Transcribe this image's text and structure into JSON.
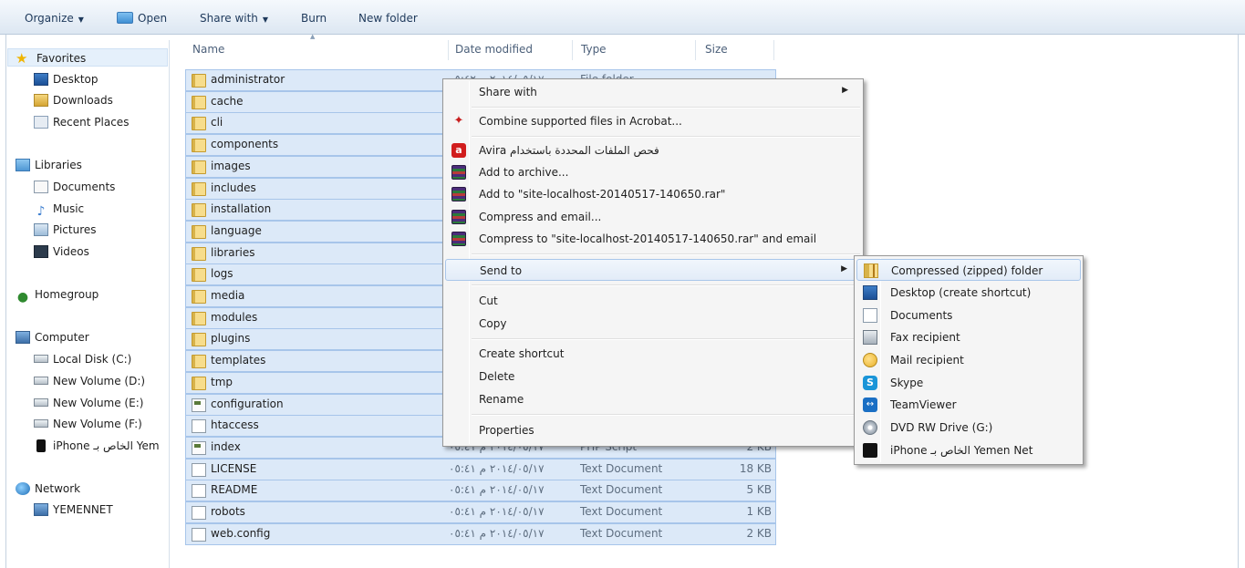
{
  "toolbar": {
    "organize": "Organize",
    "open": "Open",
    "share_with": "Share with",
    "burn": "Burn",
    "new_folder": "New folder"
  },
  "nav": {
    "favorites": "Favorites",
    "desktop": "Desktop",
    "downloads": "Downloads",
    "recent_places": "Recent Places",
    "libraries": "Libraries",
    "documents": "Documents",
    "music": "Music",
    "pictures": "Pictures",
    "videos": "Videos",
    "homegroup": "Homegroup",
    "computer": "Computer",
    "local_disk": "Local Disk (C:)",
    "vol_d": "New Volume (D:)",
    "vol_e": "New Volume (E:)",
    "vol_f": "New Volume (F:)",
    "iphone": "iPhone الخاص بـ Yem",
    "network": "Network",
    "yemennet": "YEMENNET"
  },
  "columns": {
    "name": "Name",
    "date_modified": "Date modified",
    "type": "Type",
    "size": "Size"
  },
  "files": [
    {
      "name": "administrator",
      "date": "٢٠١٤/٠٥/١٧ م ٠٥:٤٢",
      "type": "File folder",
      "size": "",
      "icon": "folder-icon"
    },
    {
      "name": "cache",
      "date": "",
      "type": "",
      "size": "",
      "icon": "folder-icon"
    },
    {
      "name": "cli",
      "date": "",
      "type": "",
      "size": "",
      "icon": "folder-icon"
    },
    {
      "name": "components",
      "date": "",
      "type": "",
      "size": "",
      "icon": "folder-icon"
    },
    {
      "name": "images",
      "date": "",
      "type": "",
      "size": "",
      "icon": "folder-icon"
    },
    {
      "name": "includes",
      "date": "",
      "type": "",
      "size": "",
      "icon": "folder-icon"
    },
    {
      "name": "installation",
      "date": "",
      "type": "",
      "size": "",
      "icon": "folder-icon"
    },
    {
      "name": "language",
      "date": "",
      "type": "",
      "size": "",
      "icon": "folder-icon"
    },
    {
      "name": "libraries",
      "date": "",
      "type": "",
      "size": "",
      "icon": "folder-icon"
    },
    {
      "name": "logs",
      "date": "",
      "type": "",
      "size": "",
      "icon": "folder-icon"
    },
    {
      "name": "media",
      "date": "",
      "type": "",
      "size": "",
      "icon": "folder-icon"
    },
    {
      "name": "modules",
      "date": "",
      "type": "",
      "size": "",
      "icon": "folder-icon"
    },
    {
      "name": "plugins",
      "date": "",
      "type": "",
      "size": "",
      "icon": "folder-icon"
    },
    {
      "name": "templates",
      "date": "",
      "type": "",
      "size": "",
      "icon": "folder-icon"
    },
    {
      "name": "tmp",
      "date": "",
      "type": "",
      "size": "",
      "icon": "folder-icon"
    },
    {
      "name": "configuration",
      "date": "",
      "type": "",
      "size": "",
      "icon": "php-file-icon"
    },
    {
      "name": "htaccess",
      "date": "",
      "type": "",
      "size": "",
      "icon": "text-file-icon"
    },
    {
      "name": "index",
      "date": "٢٠١٤/٠٥/١٧ م ٠٥:٤١",
      "type": "PHP Script",
      "size": "2 KB",
      "icon": "php-file-icon"
    },
    {
      "name": "LICENSE",
      "date": "٢٠١٤/٠٥/١٧ م ٠٥:٤١",
      "type": "Text Document",
      "size": "18 KB",
      "icon": "text-file-icon"
    },
    {
      "name": "README",
      "date": "٢٠١٤/٠٥/١٧ م ٠٥:٤١",
      "type": "Text Document",
      "size": "5 KB",
      "icon": "text-file-icon"
    },
    {
      "name": "robots",
      "date": "٢٠١٤/٠٥/١٧ م ٠٥:٤١",
      "type": "Text Document",
      "size": "1 KB",
      "icon": "text-file-icon"
    },
    {
      "name": "web.config",
      "date": "٢٠١٤/٠٥/١٧ م ٠٥:٤١",
      "type": "Text Document",
      "size": "2 KB",
      "icon": "text-file-icon"
    }
  ],
  "context_menu": {
    "share_with": "Share with",
    "combine_acrobat": "Combine supported files in Acrobat...",
    "avira_scan": "Avira فحص الملفات المحددة باستخدام",
    "add_to_archive": "Add to archive...",
    "add_to_rar": "Add to \"site-localhost-20140517-140650.rar\"",
    "compress_email": "Compress and email...",
    "compress_rar_email": "Compress to \"site-localhost-20140517-140650.rar\" and email",
    "send_to": "Send to",
    "cut": "Cut",
    "copy": "Copy",
    "create_shortcut": "Create shortcut",
    "delete": "Delete",
    "rename": "Rename",
    "properties": "Properties"
  },
  "send_to_menu": {
    "compressed_folder": "Compressed (zipped) folder",
    "desktop_shortcut": "Desktop (create shortcut)",
    "documents": "Documents",
    "fax_recipient": "Fax recipient",
    "mail_recipient": "Mail recipient",
    "skype": "Skype",
    "teamviewer": "TeamViewer",
    "dvd_drive": "DVD RW Drive (G:)",
    "iphone": "iPhone الخاص بـ Yemen Net"
  },
  "colors": {
    "selection": "#dce9f8",
    "selection_border": "#a7c5ea",
    "menu_bg": "#f5f5f5"
  }
}
